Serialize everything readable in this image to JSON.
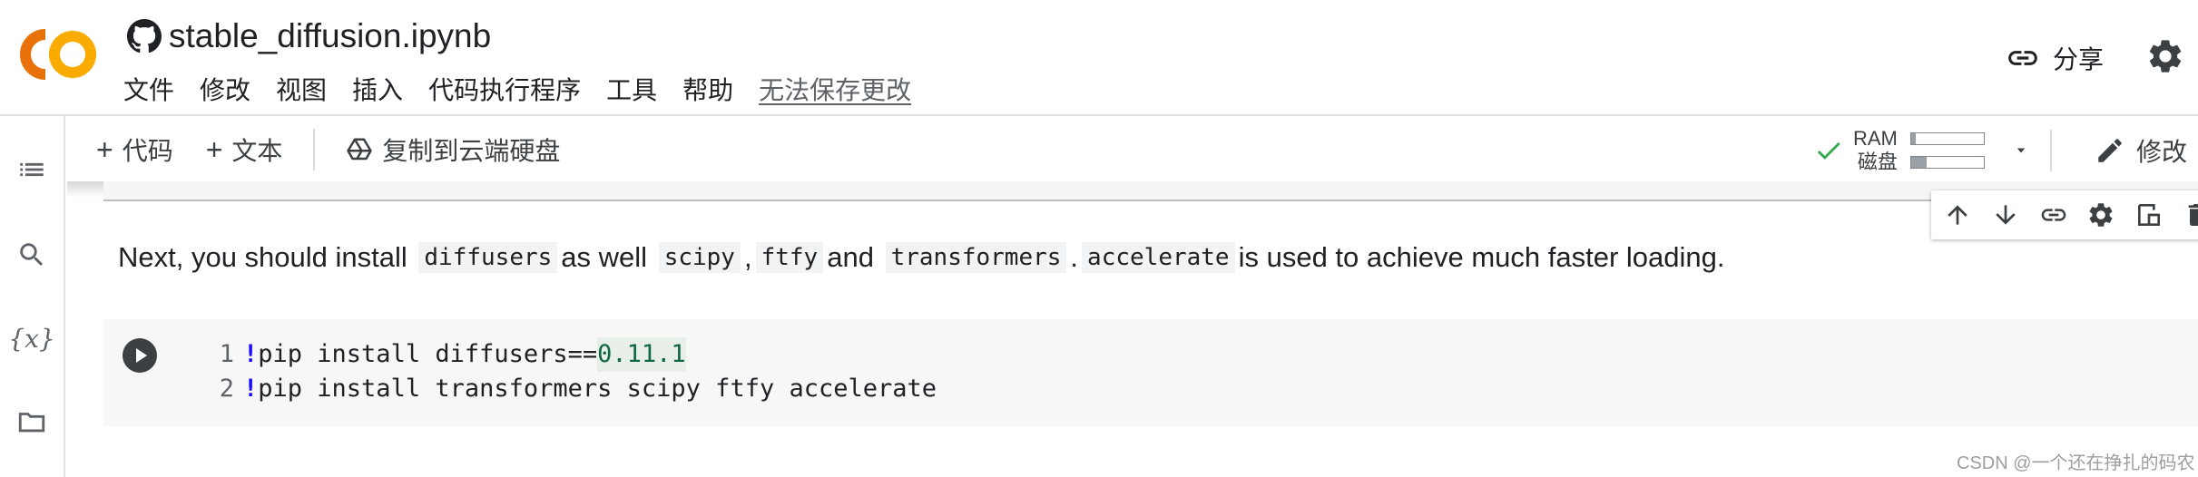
{
  "header": {
    "notebook_title": "stable_diffusion.ipynb",
    "menu": [
      "文件",
      "修改",
      "视图",
      "插入",
      "代码执行程序",
      "工具",
      "帮助"
    ],
    "save_notice": "无法保存更改",
    "share_label": "分享"
  },
  "toolbar": {
    "add_code_label": "代码",
    "add_text_label": "文本",
    "copy_drive_label": "复制到云端硬盘",
    "ram_label": "RAM",
    "disk_label": "磁盘",
    "ram_usage": 0.06,
    "disk_usage": 0.22,
    "edit_label": "修改"
  },
  "text_cell": {
    "t1": "Next, you should install",
    "c1": "diffusers",
    "t2": "as well",
    "c2": "scipy",
    "t3": ",",
    "c3": "ftfy",
    "t4": "and",
    "c4": "transformers",
    "t5": ".",
    "c5": "accelerate",
    "t6": "is used to achieve much faster loading."
  },
  "code_cell": {
    "lines": [
      {
        "num": "1",
        "bang": "!",
        "code": "pip install diffusers==",
        "version": "0.11.1"
      },
      {
        "num": "2",
        "bang": "!",
        "code": "pip install transformers scipy ftfy accelerate"
      }
    ]
  },
  "watermark": "CSDN @一个还在挣扎的码农",
  "colors": {
    "logo_orange": "#F9AB00",
    "logo_dark_orange": "#E8710A",
    "check_green": "#34A853",
    "bang_blue": "#1A0DFF",
    "number_green": "#116644"
  }
}
